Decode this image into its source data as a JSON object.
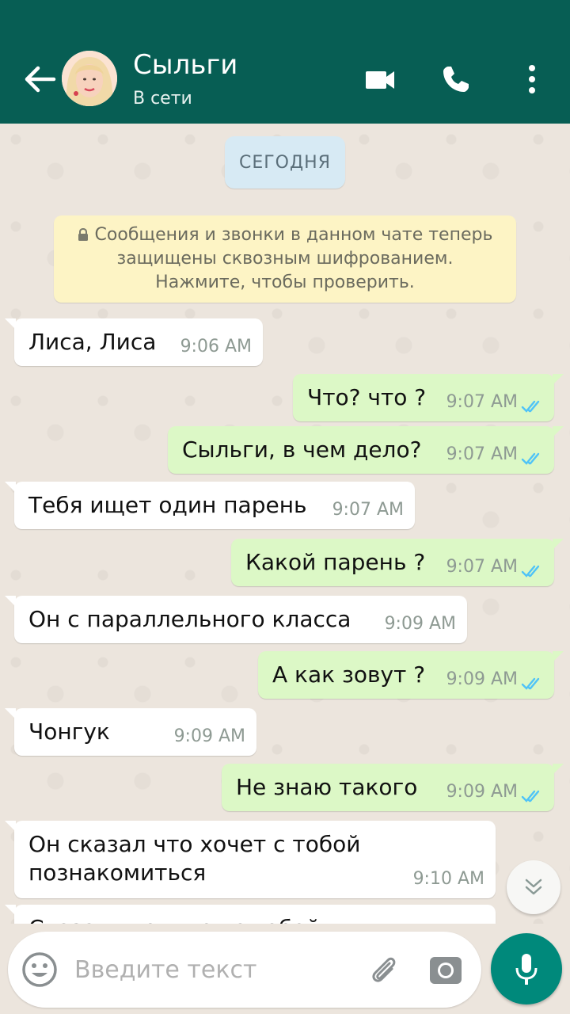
{
  "header": {
    "contact_name": "Сыльги",
    "status": "В сети"
  },
  "chat": {
    "date_label": "СЕГОДНЯ",
    "encryption_notice": {
      "line1": "Сообщения и звонки в данном чате теперь",
      "line2": "защищены сквозным шифрованием.",
      "line3": "Нажмите, чтобы проверить."
    },
    "messages": [
      {
        "direction": "in",
        "text": "Лиса, Лиса",
        "time": "9:06 AM"
      },
      {
        "direction": "out",
        "text": "Что? что ?",
        "time": "9:07 AM",
        "read": true
      },
      {
        "direction": "out",
        "text": "Сыльги, в чем дело?",
        "time": "9:07 AM",
        "read": true
      },
      {
        "direction": "in",
        "text": "Тебя ищет один парень",
        "time": "9:07 AM"
      },
      {
        "direction": "out",
        "text": "Какой парень ?",
        "time": "9:07 AM",
        "read": true
      },
      {
        "direction": "in",
        "text": "Он с параллельного класса",
        "time": "9:09 AM"
      },
      {
        "direction": "out",
        "text": "А как зовут ?",
        "time": "9:09 AM",
        "read": true
      },
      {
        "direction": "in",
        "text": "Чонгук",
        "time": "9:09 AM"
      },
      {
        "direction": "out",
        "text": "Не знаю такого",
        "time": "9:09 AM",
        "read": true
      },
      {
        "direction": "in",
        "text": "Он сказал что хочет с тобой познакомиться",
        "line1": "Он сказал что хочет с тобой",
        "line2": "познакомиться",
        "time": "9:10 AM"
      },
      {
        "direction": "in",
        "text": "Сказал что ждет с тобой",
        "time": ""
      }
    ]
  },
  "composer": {
    "placeholder": "Введите текст"
  },
  "colors": {
    "header": "#075e54",
    "outgoing_bubble": "#dcf8c6",
    "incoming_bubble": "#ffffff",
    "read_ticks": "#4fc3f7",
    "mic_button": "#00897b"
  }
}
